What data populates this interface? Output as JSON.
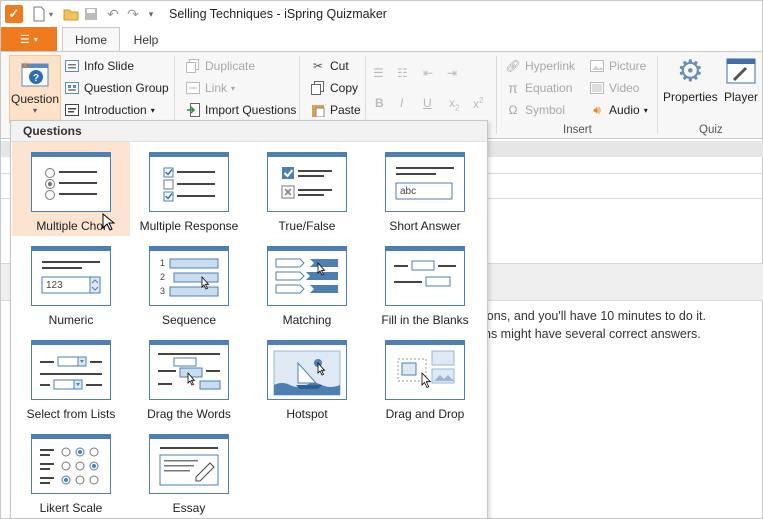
{
  "window": {
    "title": "Selling Techniques - iSpring Quizmaker"
  },
  "quick_access": [
    "new-icon",
    "open-icon",
    "save-icon",
    "undo-icon",
    "redo-icon",
    "customize-icon"
  ],
  "tabs": {
    "home": "Home",
    "help": "Help"
  },
  "ribbon": {
    "question": "Question",
    "info_slide": "Info Slide",
    "question_group": "Question Group",
    "introduction": "Introduction",
    "duplicate": "Duplicate",
    "link": "Link",
    "import_questions": "Import Questions",
    "cut": "Cut",
    "copy": "Copy",
    "paste": "Paste",
    "hyperlink": "Hyperlink",
    "equation": "Equation",
    "symbol": "Symbol",
    "picture": "Picture",
    "video": "Video",
    "audio": "Audio",
    "properties": "Properties",
    "player": "Player",
    "group_insert": "Insert",
    "group_quiz": "Quiz"
  },
  "content": {
    "line1": "ions, and you'll have 10 minutes to do it.",
    "line2": "ns might have several correct answers."
  },
  "dropdown": {
    "header": "Questions",
    "items": [
      {
        "label": "Multiple Choi",
        "icon": "multiple-choice-icon"
      },
      {
        "label": "Multiple Response",
        "icon": "multiple-response-icon"
      },
      {
        "label": "True/False",
        "icon": "true-false-icon"
      },
      {
        "label": "Short Answer",
        "icon": "short-answer-icon"
      },
      {
        "label": "Numeric",
        "icon": "numeric-icon"
      },
      {
        "label": "Sequence",
        "icon": "sequence-icon"
      },
      {
        "label": "Matching",
        "icon": "matching-icon"
      },
      {
        "label": "Fill in the Blanks",
        "icon": "fill-in-blanks-icon"
      },
      {
        "label": "Select from Lists",
        "icon": "select-from-lists-icon"
      },
      {
        "label": "Drag the Words",
        "icon": "drag-the-words-icon"
      },
      {
        "label": "Hotspot",
        "icon": "hotspot-icon"
      },
      {
        "label": "Drag and Drop",
        "icon": "drag-and-drop-icon"
      },
      {
        "label": "Likert Scale",
        "icon": "likert-scale-icon"
      },
      {
        "label": "Essay",
        "icon": "essay-icon"
      }
    ],
    "thumb_texts": {
      "short_answer": "abc",
      "numeric": "123",
      "seq1": "1",
      "seq2": "2",
      "seq3": "3"
    }
  },
  "colors": {
    "accent": "#f07a1e",
    "thumb_blue": "#4e7fb3",
    "hover": "#fde4d1"
  }
}
